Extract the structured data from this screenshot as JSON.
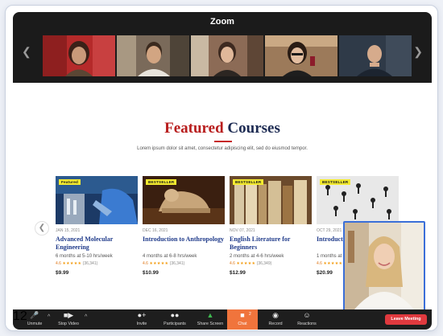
{
  "window": {
    "title": "Zoom"
  },
  "participants": [
    {
      "name": "participant-1",
      "bg": "#b52a2a"
    },
    {
      "name": "participant-2",
      "bg": "#6b5a4a"
    },
    {
      "name": "participant-3",
      "bg": "#8c6b56"
    },
    {
      "name": "participant-4",
      "bg": "#9c7a5a"
    },
    {
      "name": "participant-5",
      "bg": "#2f3a48"
    }
  ],
  "page": {
    "heading_accent": "Featured",
    "heading_rest": " Courses",
    "subtitle": "Lorem ipsum dolor sit amet, consectetur adipiscing elit, sed do eiusmod tempor."
  },
  "courses": [
    {
      "badge": "Featured",
      "date": "JAN 15, 2021",
      "title": "Advanced Molecular Engineering",
      "meta": "6 months at  5-10 hrs/week",
      "score": "4.6",
      "stars": "★★★★★",
      "reviews": "(36,341)",
      "price": "$9.99"
    },
    {
      "badge": "BESTSELLER",
      "date": "DEC 16, 2021",
      "title": "Introduction to Anthropology",
      "meta": "4 months at  6-8 hrs/week",
      "score": "4.6",
      "stars": "★★★★★",
      "reviews": "(36,341)",
      "price": "$10.99"
    },
    {
      "badge": "BESTSELLER",
      "date": "NOV 07, 2021",
      "title": "English Literature for Beginners",
      "meta": "2 months at  4-6 hrs/week",
      "score": "4.6",
      "stars": "★★★★★",
      "reviews": "(36,349)",
      "price": "$12.99"
    },
    {
      "badge": "BESTSELLER",
      "date": "OCT 29, 2021",
      "title": "Introducti",
      "meta": "1 months at",
      "score": "4.6",
      "stars": "★★★★★",
      "reviews": "",
      "price": "$20.99"
    }
  ],
  "toolbar": {
    "unmute": "Unmute",
    "stop_video": "Stop Video",
    "invite": "Invite",
    "participants": "Participants",
    "participants_count": "12",
    "share_screen": "Share Screen",
    "chat": "Chat",
    "chat_badge": "2",
    "record": "Record",
    "reactions": "Reactions",
    "leave": "Leave Meeting"
  },
  "colors": {
    "accent_red": "#b81d1d",
    "navy": "#1c2a52",
    "link_blue": "#1f3a8a",
    "chat_orange": "#f0743c",
    "leave_red": "#e0393e",
    "badge_yellow": "#f3ea2f"
  }
}
